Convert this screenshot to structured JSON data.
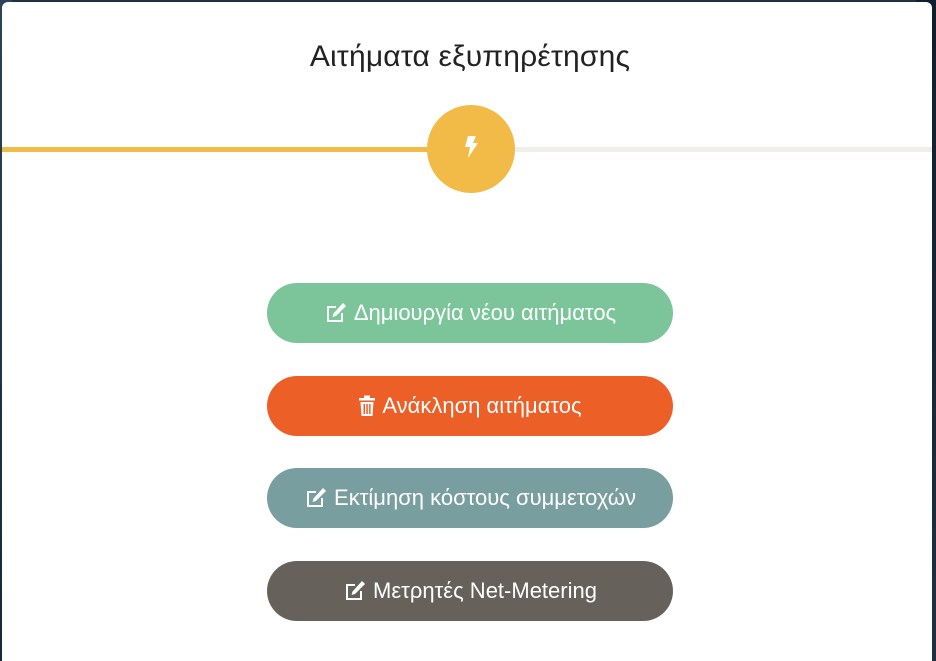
{
  "dialog": {
    "title": "Αιτήματα εξυπηρέτησης",
    "progress_percent": 46,
    "step_icon": "lightning-bolt-icon"
  },
  "actions": [
    {
      "label": "Δημιουργία νέου αιτήματος",
      "icon": "edit-icon",
      "color": "#7cc59b"
    },
    {
      "label": "Ανάκληση αιτήματος",
      "icon": "trash-icon",
      "color": "#ec5f27"
    },
    {
      "label": "Εκτίμηση κόστους συμμετοχών",
      "icon": "edit-icon",
      "color": "#799ea0"
    },
    {
      "label": "Μετρητές Net-Metering",
      "icon": "edit-icon",
      "color": "#67615b"
    }
  ],
  "colors": {
    "accent": "#f2bb47",
    "track": "#f0eeeb"
  }
}
